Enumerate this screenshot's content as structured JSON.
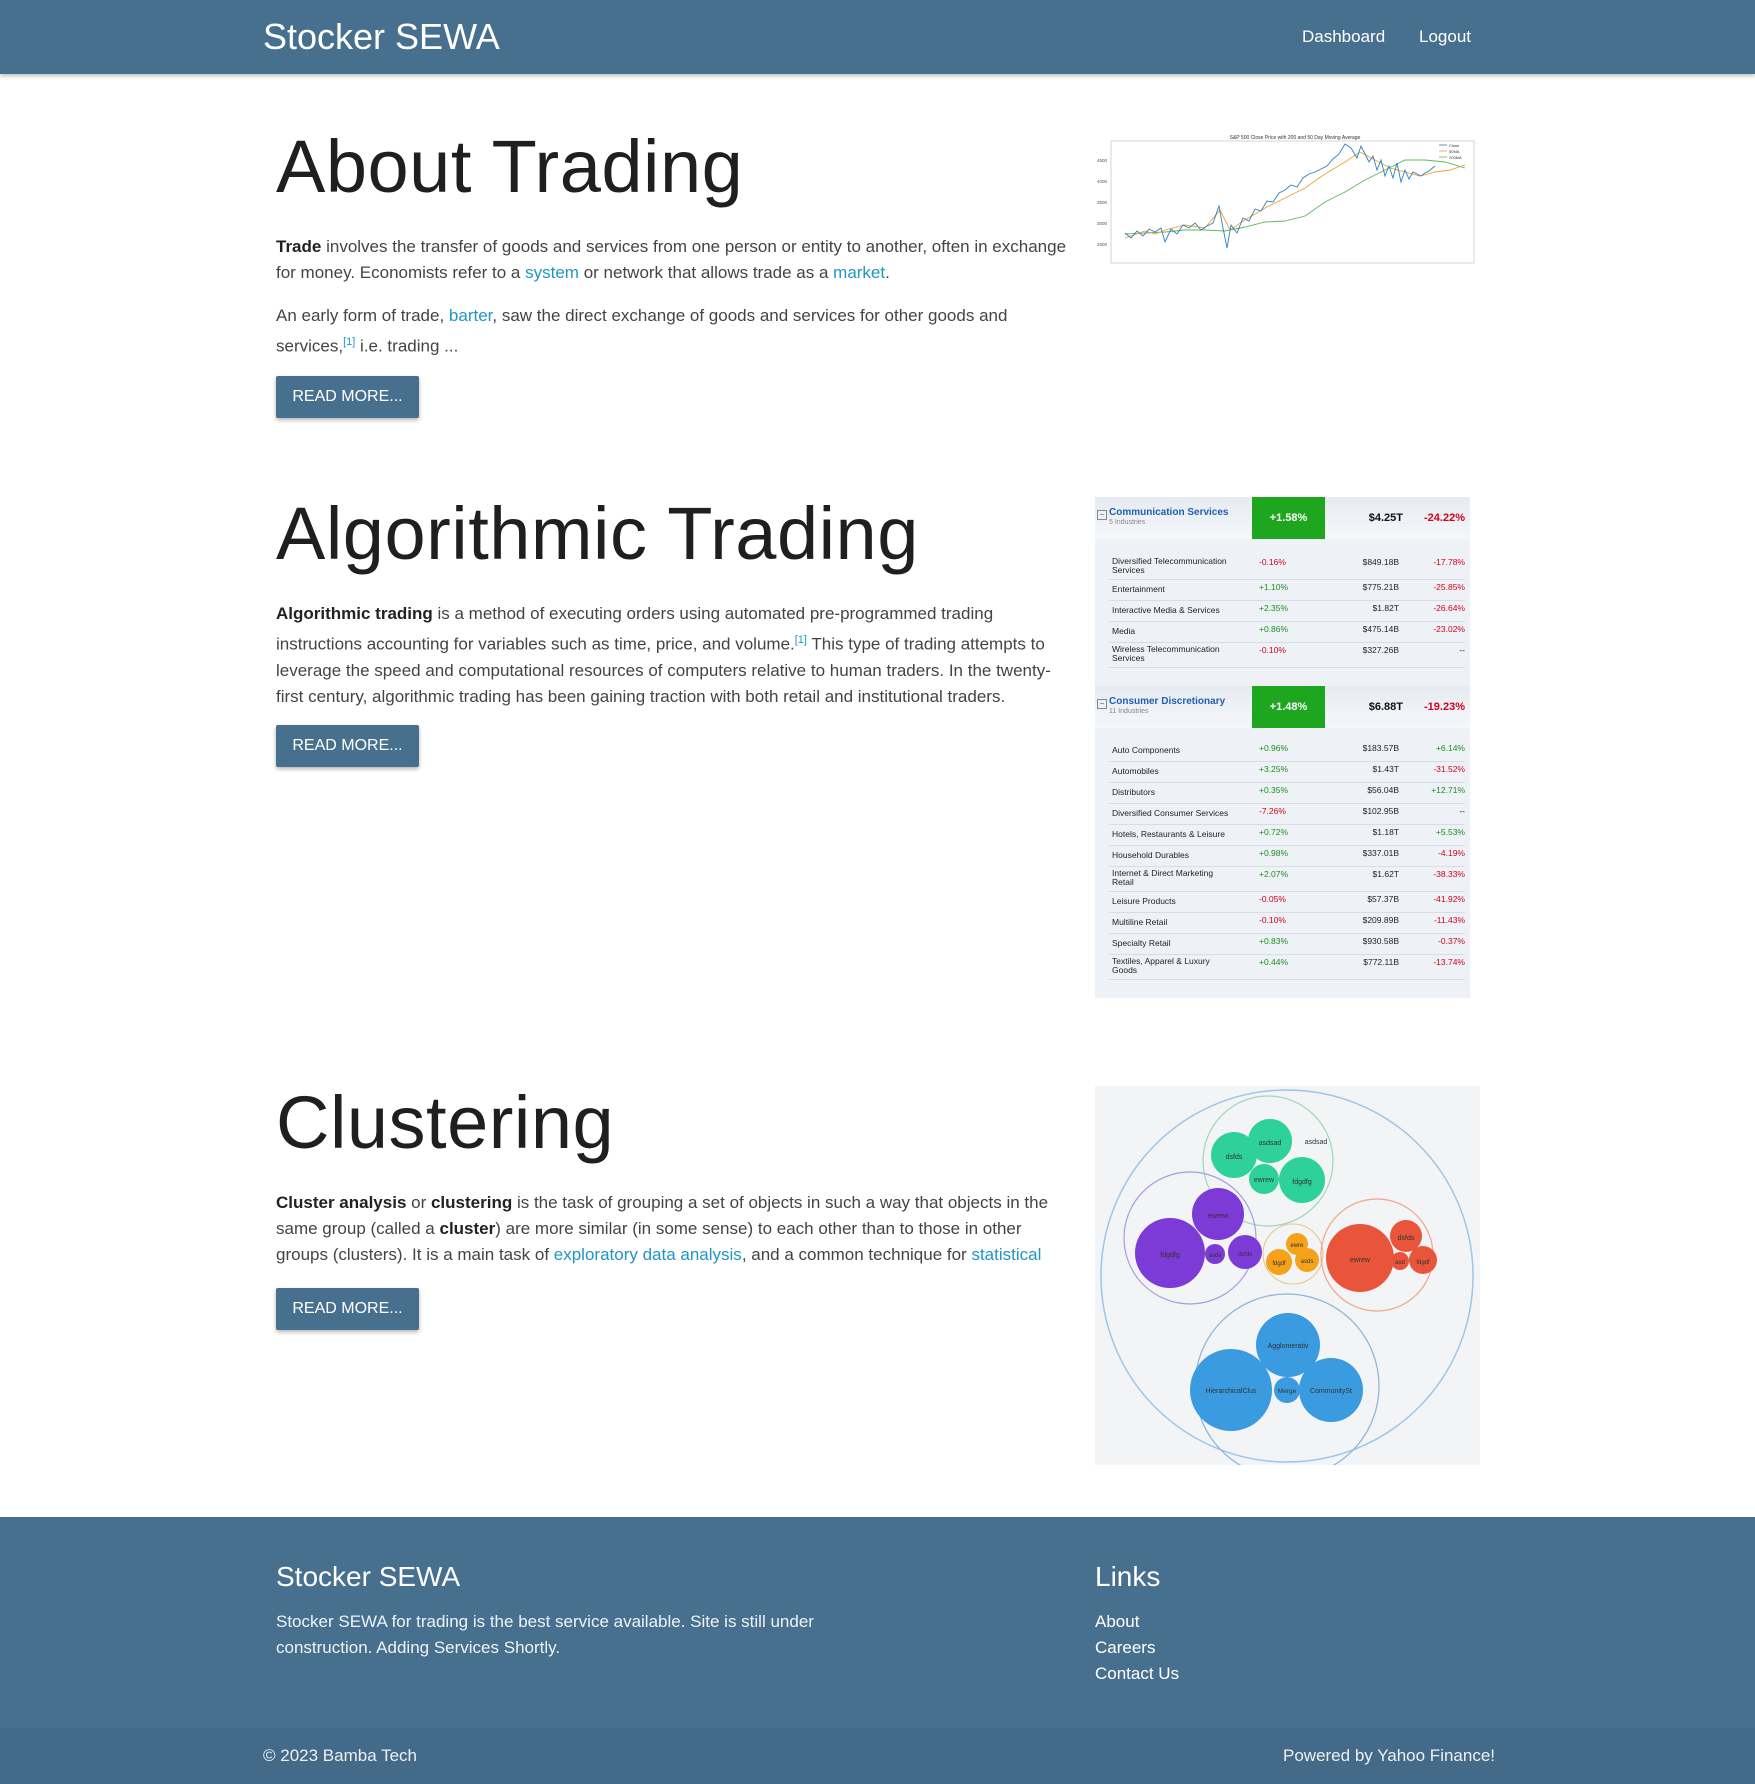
{
  "nav": {
    "brand": "Stocker SEWA",
    "links": [
      "Dashboard",
      "Logout"
    ]
  },
  "about": {
    "title": "About Trading",
    "p1": {
      "b": "Trade",
      "t1": " involves the transfer of goods and services from one person or entity to another, often in exchange for money. Economists refer to a ",
      "l1": "system",
      "t2": " or network that allows trade as a ",
      "l2": "market",
      "t3": "."
    },
    "p2": {
      "t1": "An early form of trade, ",
      "l1": "barter",
      "t2": ", saw the direct exchange of goods and services for other goods and services,",
      "sup": "[1]",
      "t3": " i.e. trading ..."
    },
    "button": "READ MORE..."
  },
  "sp500": {
    "title": "S&P 500 Close Price with 200 and 50 Day Moving Average",
    "legend": [
      "Close",
      "50MA",
      "200MA"
    ],
    "yticks": [
      "4500",
      "4000",
      "3500",
      "3000",
      "2500"
    ],
    "colors": {
      "close": "#2f7fc1",
      "ma50": "#f0a030",
      "ma200": "#5cb85c"
    }
  },
  "algo": {
    "title": "Algorithmic Trading",
    "p1": {
      "b": "Algorithmic trading",
      "t1": " is a method of executing orders using automated pre-programmed trading instructions accounting for variables such as time, price, and volume.",
      "sup": "[1]",
      "t2": " This type of trading attempts to leverage the speed and computational resources of computers relative to human traders. In the twenty-first century, algorithmic trading has been gaining traction with both retail and institutional traders."
    },
    "button": "READ MORE..."
  },
  "sectors": [
    {
      "name": "Communication Services",
      "sub": "5 Industries",
      "toggle": "−",
      "chg": "+1.58%",
      "cap": "$4.25T",
      "ytd": "-24.22%",
      "rows": [
        {
          "name": "Diversified Telecommunication Services",
          "chg": "-0.16%",
          "cap": "$849.18B",
          "ytd": "-17.78%"
        },
        {
          "name": "Entertainment",
          "chg": "+1.10%",
          "cap": "$775.21B",
          "ytd": "-25.85%"
        },
        {
          "name": "Interactive Media & Services",
          "chg": "+2.35%",
          "cap": "$1.82T",
          "ytd": "-26.64%"
        },
        {
          "name": "Media",
          "chg": "+0.86%",
          "cap": "$475.14B",
          "ytd": "-23.02%"
        },
        {
          "name": "Wireless Telecommunication Services",
          "chg": "-0.10%",
          "cap": "$327.26B",
          "ytd": "--"
        }
      ]
    },
    {
      "name": "Consumer Discretionary",
      "sub": "11 Industries",
      "toggle": "−",
      "chg": "+1.48%",
      "cap": "$6.88T",
      "ytd": "-19.23%",
      "rows": [
        {
          "name": "Auto Components",
          "chg": "+0.96%",
          "cap": "$183.57B",
          "ytd": "+6.14%"
        },
        {
          "name": "Automobiles",
          "chg": "+3.25%",
          "cap": "$1.43T",
          "ytd": "-31.52%"
        },
        {
          "name": "Distributors",
          "chg": "+0.35%",
          "cap": "$56.04B",
          "ytd": "+12.71%"
        },
        {
          "name": "Diversified Consumer Services",
          "chg": "-7.26%",
          "cap": "$102.95B",
          "ytd": "--"
        },
        {
          "name": "Hotels, Restaurants & Leisure",
          "chg": "+0.72%",
          "cap": "$1.18T",
          "ytd": "+5.53%"
        },
        {
          "name": "Household Durables",
          "chg": "+0.98%",
          "cap": "$337.01B",
          "ytd": "-4.19%"
        },
        {
          "name": "Internet & Direct Marketing Retail",
          "chg": "+2.07%",
          "cap": "$1.62T",
          "ytd": "-38.33%"
        },
        {
          "name": "Leisure Products",
          "chg": "-0.05%",
          "cap": "$57.37B",
          "ytd": "-41.92%"
        },
        {
          "name": "Multiline Retail",
          "chg": "-0.10%",
          "cap": "$209.89B",
          "ytd": "-11.43%"
        },
        {
          "name": "Specialty Retail",
          "chg": "+0.83%",
          "cap": "$930.58B",
          "ytd": "-0.37%"
        },
        {
          "name": "Textiles, Apparel & Luxury Goods",
          "chg": "+0.44%",
          "cap": "$772.11B",
          "ytd": "-13.74%"
        }
      ]
    }
  ],
  "cluster": {
    "title": "Clustering",
    "p1": {
      "b1": "Cluster analysis",
      "t1": " or ",
      "b2": "clustering",
      "t2": " is the task of grouping a set of objects in such a way that objects in the same group (called a ",
      "b3": "cluster",
      "t3": ") are more similar (in some sense) to each other than to those in other groups (clusters). It is a main task of ",
      "l1": "exploratory data analysis",
      "t4": ", and a common technique for ",
      "l2": "statistical"
    },
    "button": "READ MORE...",
    "bubble_labels": {
      "green": [
        "asdsad",
        "dsfds",
        "ewrew",
        "fdgdfg"
      ],
      "purple": [
        "ewrew",
        "fdgdfg",
        "asds",
        "dsfds"
      ],
      "orange": [
        "ewre",
        "fdgdf",
        "asds"
      ],
      "red": [
        "ewrew",
        "dsfds",
        "asd",
        "fdgdf"
      ],
      "blue": [
        "Agglomerativ",
        "HierarchicalClus",
        "Merge",
        "CommunitySt"
      ]
    },
    "colors": {
      "green": "#2fd19a",
      "purple": "#7c3ad6",
      "orange": "#f5a21a",
      "red": "#e8553a",
      "blue": "#3a9be0"
    }
  },
  "footer": {
    "title": "Stocker SEWA",
    "text": "Stocker SEWA for trading is the best service available. Site is still under construction. Adding Services Shortly.",
    "links_title": "Links",
    "links": [
      "About",
      "Careers",
      "Contact Us"
    ],
    "copyright": "© 2023 Bamba Tech",
    "powered": "Powered by Yahoo Finance!"
  }
}
